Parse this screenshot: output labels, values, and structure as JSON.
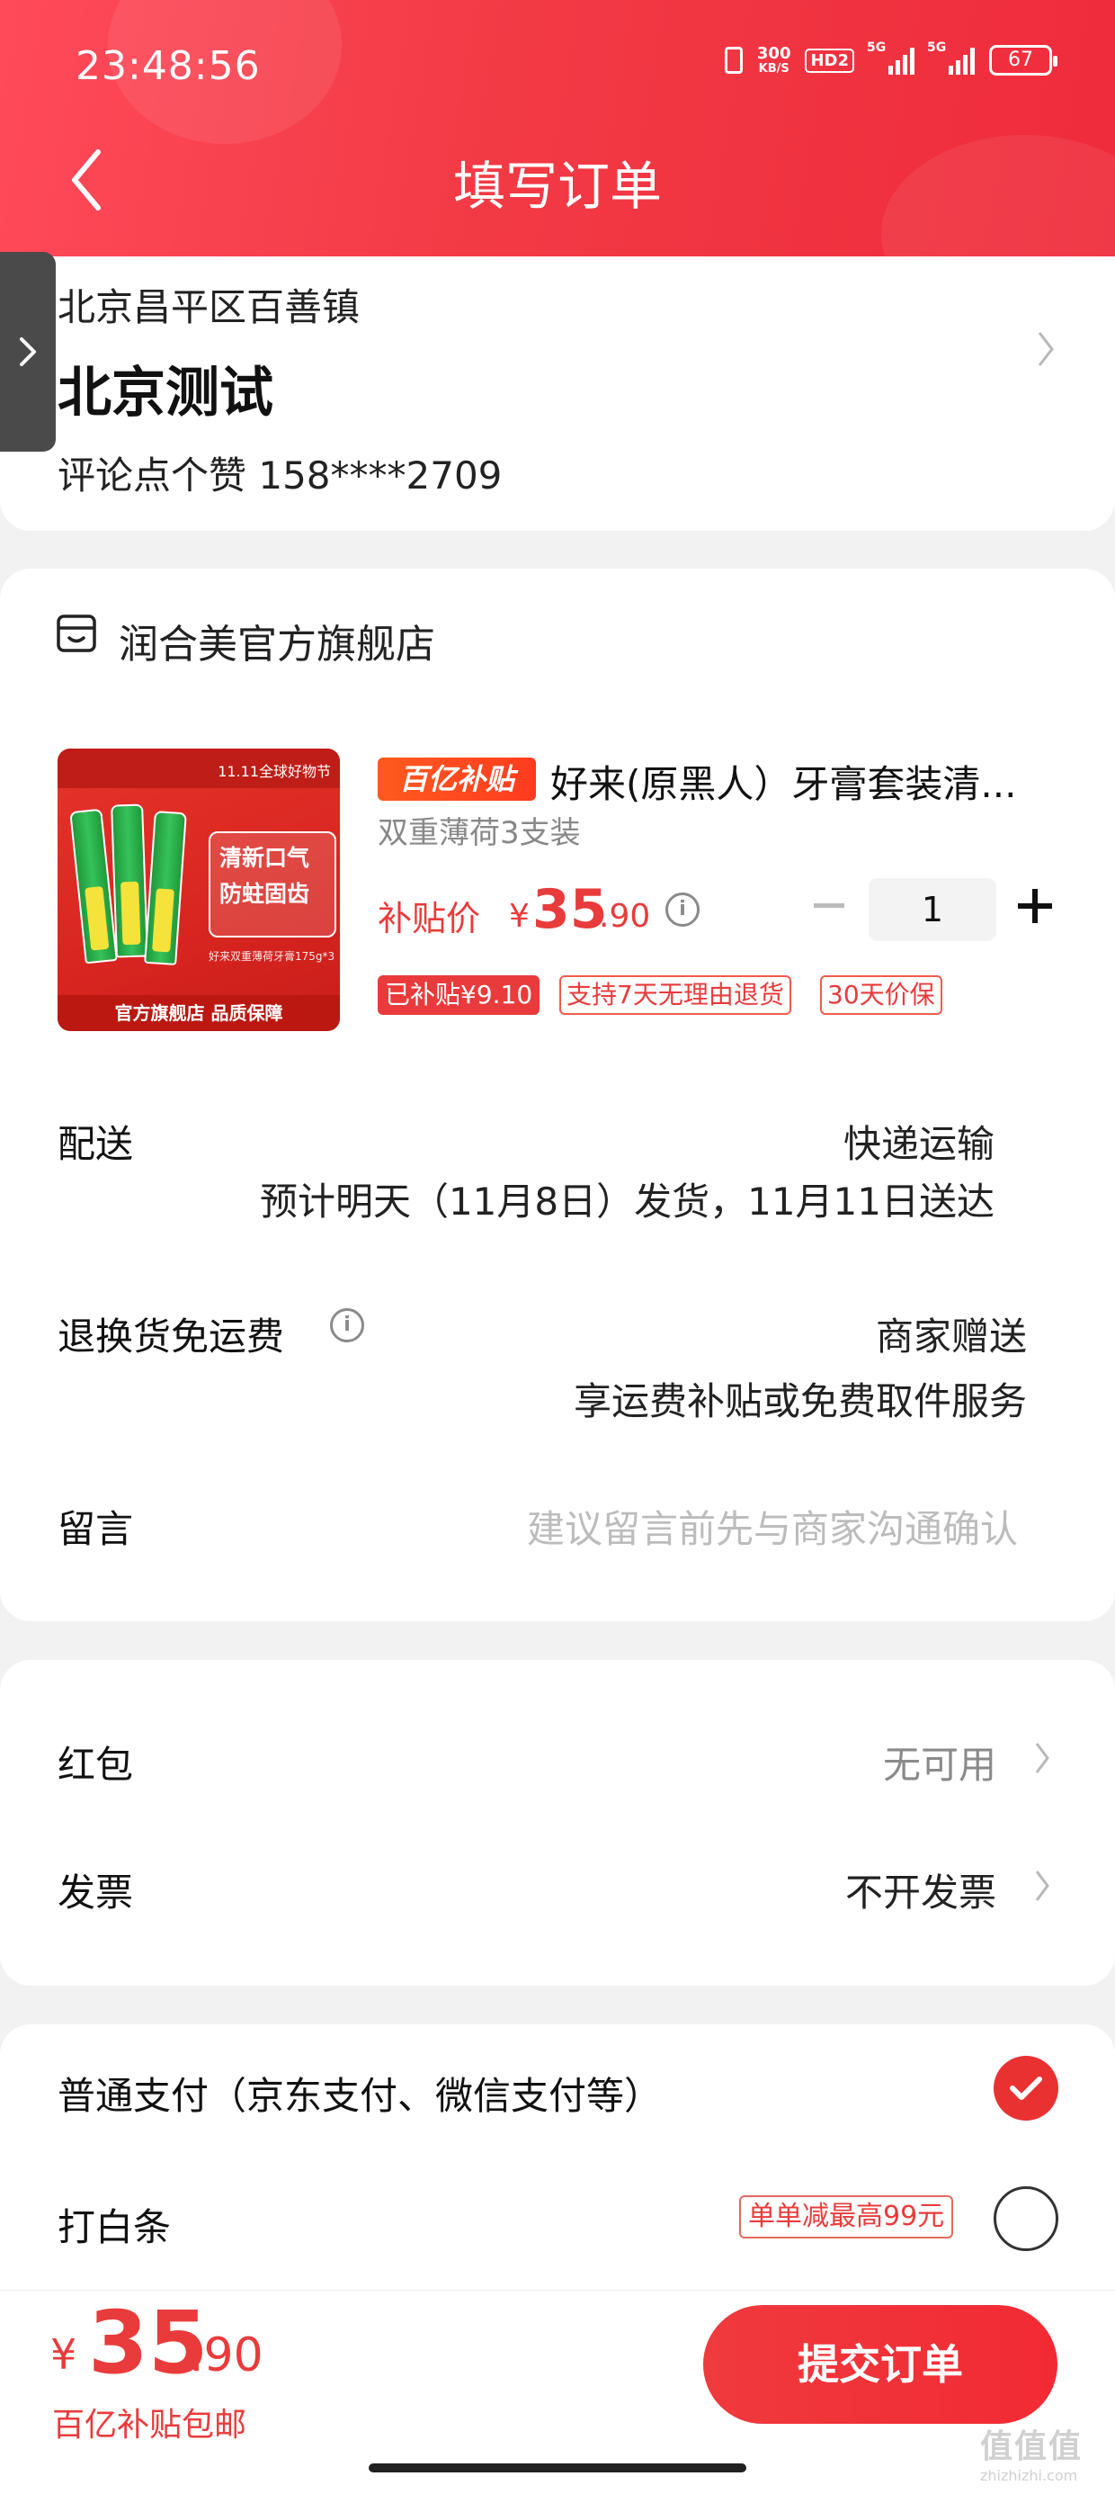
{
  "status_bar": {
    "time": "23:48:56",
    "speed_value": "300",
    "speed_unit": "KB/S",
    "hd_label": "HD2",
    "signal1_label": "5G",
    "signal2_label": "5G",
    "battery": "67"
  },
  "header": {
    "title": "填写订单",
    "background_color": "#f23a45"
  },
  "address": {
    "region": "北京昌平区百善镇",
    "name": "北京测试",
    "contact": "评论点个赞  158****2709"
  },
  "store": {
    "name": "润合美官方旗舰店",
    "product": {
      "image_top_text": "11.11全球好物节",
      "image_bubble_line1": "清新口气",
      "image_bubble_line2": "防蛀固齿",
      "image_small_text": "好来双重薄荷牙膏175g*3",
      "image_bottom_text": "官方旗舰店 品质保障",
      "badge": "百亿补贴",
      "title": "好来(原黑人）牙膏套装清...",
      "spec": "双重薄荷3支装",
      "price_label": "补贴价",
      "price_currency": "¥",
      "price_int": "35",
      "price_dec": ".90",
      "quantity": "1",
      "tags": [
        "已补贴¥9.10",
        "支持7天无理由退货",
        "30天价保"
      ]
    },
    "delivery": {
      "label": "配送",
      "method": "快递运输",
      "estimate": "预计明天（11月8日）发货，11月11日送达"
    },
    "return_shipping": {
      "label": "退换货免运费",
      "value": "商家赠送",
      "desc": "享运费补贴或免费取件服务"
    },
    "message": {
      "label": "留言",
      "placeholder": "建议留言前先与商家沟通确认"
    }
  },
  "extras": {
    "red_packet": {
      "label": "红包",
      "value": "无可用"
    },
    "invoice": {
      "label": "发票",
      "value": "不开发票"
    }
  },
  "payment": {
    "normal": {
      "label": "普通支付（京东支付、微信支付等）",
      "selected": true
    },
    "baitiao": {
      "label": "打白条",
      "promo": "单单减最高99元",
      "selected": false
    }
  },
  "bottom": {
    "currency": "¥",
    "total_int": "35",
    "total_dec": ".90",
    "note": "百亿补贴包邮",
    "submit_label": "提交订单",
    "accent_color": "#e93b3b"
  },
  "watermark": {
    "main": "值值值",
    "sub": "zhizhizhi.com"
  }
}
